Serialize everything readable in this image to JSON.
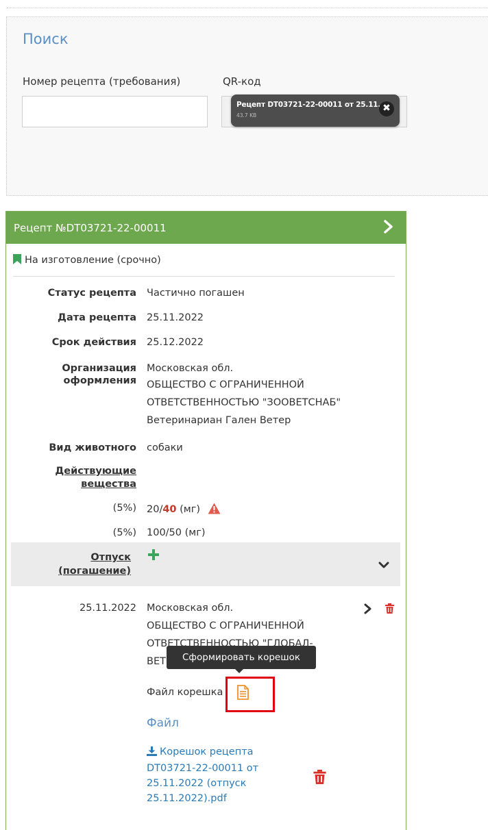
{
  "search": {
    "title": "Поиск",
    "recipe_number_label": "Номер рецепта (требования)",
    "recipe_number_value": "",
    "qr_label": "QR-код",
    "qr_file_name": "Рецепт DT03721-22-00011 от 25.11.",
    "qr_file_size": "43.7 KB",
    "qr_remove": "✖"
  },
  "recipe": {
    "header_title": "Рецепт №DT03721-22-00011",
    "type_label": "На изготовление (срочно)",
    "fields": {
      "status_label": "Статус рецепта",
      "status_value": "Частично погашен",
      "date_label": "Дата рецепта",
      "date_value": "25.11.2022",
      "validity_label": "Срок действия",
      "validity_value": "25.12.2022",
      "org_label_1": "Организация",
      "org_label_2": "оформления",
      "org_line_1": "Московская обл.",
      "org_line_2": "ОБЩЕСТВО С ОГРАНИЧЕННОЙ",
      "org_line_3": "ОТВЕТСТВЕННОСТЬЮ \"ЗООВЕТСНАБ\"",
      "org_line_4": "Ветеринариан Гален Ветер",
      "animal_label": "Вид животного",
      "animal_value": "собаки",
      "substances_label_1": "Действующие",
      "substances_label_2": "вещества"
    },
    "substances": [
      {
        "percent": "(5%)",
        "dose_prefix": "20/",
        "dose_strong": "40",
        "unit": " (мг)"
      },
      {
        "percent": "(5%)",
        "dose_prefix": "100/50",
        "dose_strong": "",
        "unit": " (мг)"
      }
    ],
    "issue": {
      "label_1": "Отпуск",
      "label_2": "(погашение)",
      "date": "25.11.2022",
      "org_line_1": "Московская обл.",
      "org_line_2": "ОБЩЕСТВО С ОГРАНИЧЕННОЙ",
      "org_line_3": "ОТВЕТСТВЕННОСТЬЮ \"ГЛОБАЛ-",
      "org_line_4": "ВЕТ",
      "tooltip": "Сформировать корешок",
      "stub_file_label": "Файл корешка",
      "file_label": "Файл",
      "download_line_1": "Корешок рецепта",
      "download_line_2": "DT03721-22-00011 от",
      "download_line_3": "25.11.2022 (отпуск",
      "download_line_4": "25.11.2022).pdf"
    }
  },
  "colors": {
    "header_green": "#6ea84e",
    "link_blue": "#2a7ab8",
    "title_blue": "#5a8fc4",
    "danger_red": "#d9302a",
    "highlight_red": "#e0000f",
    "doc_orange": "#f0902a"
  },
  "icons": [
    "chevron-right-icon",
    "bookmark-icon",
    "warning-icon",
    "plus-icon",
    "chevron-down-icon",
    "trash-icon",
    "document-icon",
    "download-icon"
  ]
}
